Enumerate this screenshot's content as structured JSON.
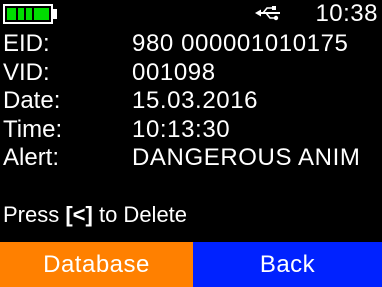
{
  "status": {
    "battery_icon": "battery-full-icon",
    "battery_level": 1.0,
    "battery_color": "#00dd00",
    "connection_icon": "usb-icon",
    "time": "10:38"
  },
  "record": {
    "eid": {
      "label": "EID:",
      "value": "980 000001010175"
    },
    "vid": {
      "label": "VID:",
      "value": "001098"
    },
    "date": {
      "label": "Date:",
      "value": "15.03.2016"
    },
    "time": {
      "label": "Time:",
      "value": "10:13:30"
    },
    "alert": {
      "label": "Alert:",
      "value": "DANGEROUS ANIM"
    }
  },
  "hint": {
    "prefix": "Press ",
    "key": "[<]",
    "suffix": " to Delete"
  },
  "softkeys": {
    "left": {
      "label": "Database",
      "color": "#ff8000"
    },
    "right": {
      "label": "Back",
      "color": "#0022ff"
    }
  }
}
